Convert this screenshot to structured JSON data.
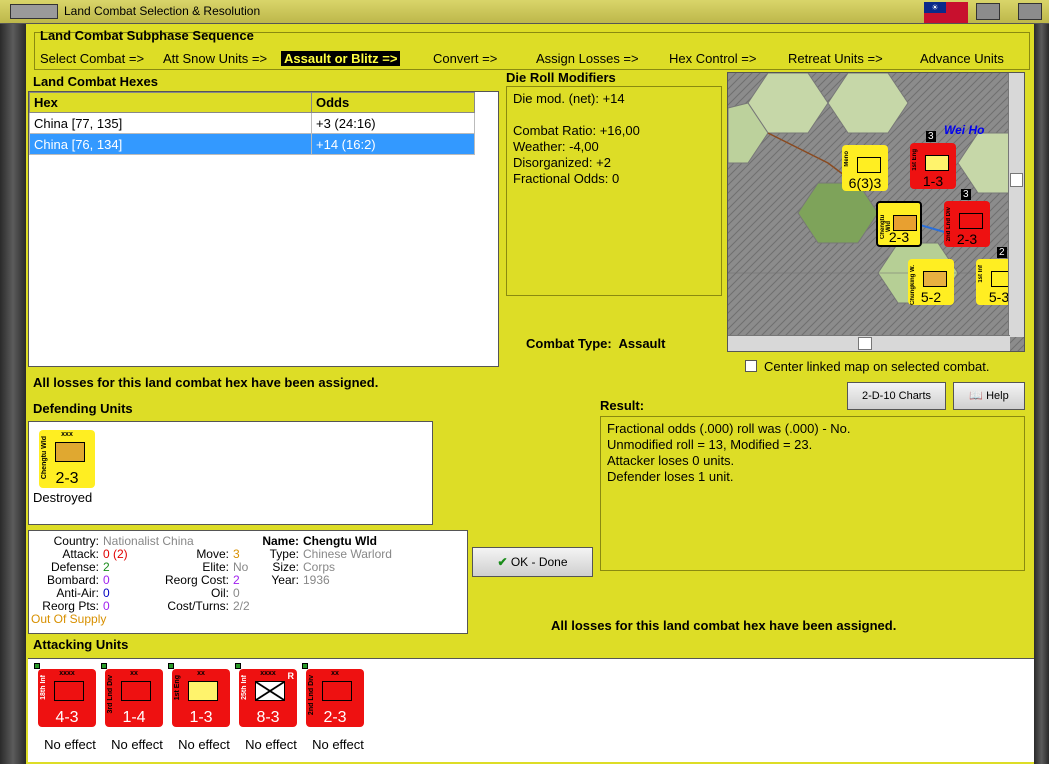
{
  "window": {
    "title": "Land Combat Selection & Resolution"
  },
  "sequence": {
    "header": "Land Combat Subphase Sequence",
    "steps": [
      "Select Combat =>",
      "Att Snow Units =>",
      "Assault or Blitz =>",
      "Convert =>",
      "Assign Losses =>",
      "Hex Control =>",
      "Retreat Units =>",
      "Advance Units"
    ]
  },
  "hexes": {
    "header": "Land Combat Hexes",
    "columns": [
      "Hex",
      "Odds"
    ],
    "rows": [
      {
        "hex": "China [77, 135]",
        "odds": "+3 (24:16)"
      },
      {
        "hex": "China [76, 134]",
        "odds": "+14 (16:2)"
      }
    ]
  },
  "modifiers": {
    "header": "Die Roll Modifiers",
    "net": "Die mod. (net): +14",
    "ratio": "Combat Ratio: +16,00",
    "weather": "Weather: -4,00",
    "disorganized": "Disorganized: +2",
    "fractional": "Fractional Odds: 0"
  },
  "map": {
    "label": "Wei Ho",
    "counters": [
      {
        "str": "6(3)3",
        "name": "Meno"
      },
      {
        "str": "1-3",
        "name": "1st Eng"
      },
      {
        "str": "2-3",
        "name": "Chengtu Wld"
      },
      {
        "str": "2-3",
        "name": "2nd Lnd Div"
      },
      {
        "str": "5-2",
        "name": "Chungking W."
      },
      {
        "str": "5-3",
        "name": "1st Inf"
      }
    ],
    "badges": [
      "3",
      "3",
      "2"
    ]
  },
  "combat_type": {
    "label": "Combat Type:",
    "value": "Assault"
  },
  "center_map": {
    "label": "Center linked map on selected combat."
  },
  "losses_msg_1": "All losses for this land combat hex have been assigned.",
  "losses_msg_2": "All losses for this land combat hex have been assigned.",
  "buttons": {
    "charts": "2-D-10 Charts",
    "help": "Help",
    "ok": "OK - Done"
  },
  "defending": {
    "header": "Defending Units",
    "units": [
      {
        "size": "xxx",
        "str": "2-3",
        "name": "Chengtu Wld",
        "status": "Destroyed"
      }
    ]
  },
  "unit_info": {
    "country_lbl": "Country:",
    "country": "Nationalist China",
    "attack_lbl": "Attack:",
    "attack": "0",
    "attack2": "(2)",
    "defense_lbl": "Defense:",
    "defense": "2",
    "bombard_lbl": "Bombard:",
    "bombard": "0",
    "antiair_lbl": "Anti-Air:",
    "antiair": "0",
    "reorgpts_lbl": "Reorg Pts:",
    "reorgpts": "0",
    "supply": "Out Of Supply",
    "move_lbl": "Move:",
    "move": "3",
    "elite_lbl": "Elite:",
    "elite": "No",
    "reorgcost_lbl": "Reorg Cost:",
    "reorgcost": "2",
    "oil_lbl": "Oil:",
    "oil": "0",
    "costturns_lbl": "Cost/Turns:",
    "costturns": "2/2",
    "name_lbl": "Name:",
    "name": "Chengtu Wld",
    "type_lbl": "Type:",
    "type": "Chinese Warlord",
    "size_lbl": "Size:",
    "size": "Corps",
    "year_lbl": "Year:",
    "year": "1936"
  },
  "result": {
    "header": "Result:",
    "lines": [
      "Fractional odds (.000) roll was (.000)  - No.",
      "Unmodified roll = 13, Modified = 23.",
      "Attacker loses 0 units.",
      "Defender loses 1 unit."
    ]
  },
  "attacking": {
    "header": "Attacking Units",
    "units": [
      {
        "size": "xxxx",
        "str": "4-3",
        "name": "18th Inf",
        "effect": "No effect"
      },
      {
        "size": "xx",
        "str": "1-4",
        "name": "3rd Lnd Div",
        "effect": "No effect"
      },
      {
        "size": "xx",
        "str": "1-3",
        "name": "1st Eng",
        "effect": "No effect"
      },
      {
        "size": "xxxx",
        "str": "8-3",
        "name": "25th Inf",
        "effect": "No effect",
        "tag": "R"
      },
      {
        "size": "xx",
        "str": "2-3",
        "name": "2nd Lnd Div",
        "effect": "No effect"
      }
    ]
  },
  "colors": {
    "panel": "#dddd26",
    "selected": "#3399ff",
    "attacker": "#ee1111",
    "defender": "#ffee22"
  }
}
